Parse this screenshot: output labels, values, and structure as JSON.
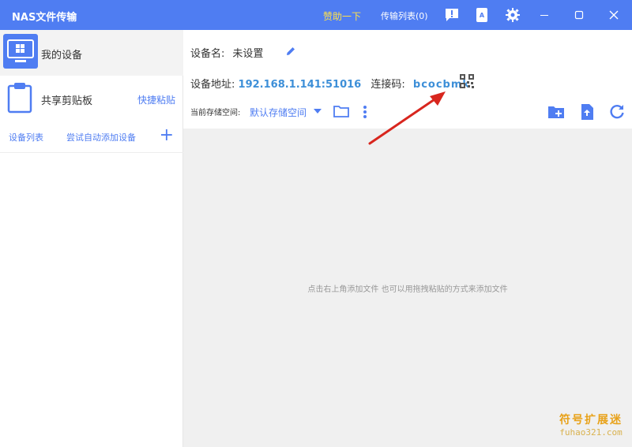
{
  "titlebar": {
    "title": "NAS文件传输",
    "donate": "赞助一下",
    "transfer_list": "传输列表(0)"
  },
  "sidebar": {
    "my_device": "我的设备",
    "shared_clipboard": "共享剪贴板",
    "quick_paste": "快捷粘贴",
    "device_list": "设备列表",
    "auto_add": "尝试自动添加设备",
    "add_symbol": "+"
  },
  "main": {
    "name_label": "设备名:",
    "name_value": "未设置",
    "address_label": "设备地址:",
    "address_value": "192.168.1.141:51016",
    "code_label": "连接码:",
    "code_value": "bcocbmk",
    "storage_label": "当前存储空间:",
    "storage_value": "默认存储空间",
    "empty_hint": "点击右上角添加文件 也可以用拖拽粘贴的方式来添加文件"
  },
  "watermark": {
    "title": "符号扩展迷",
    "url": "fuhao321.com"
  },
  "colors": {
    "accent": "#4f7df2",
    "link": "#3d8fd8",
    "donate": "#ffe14a"
  }
}
